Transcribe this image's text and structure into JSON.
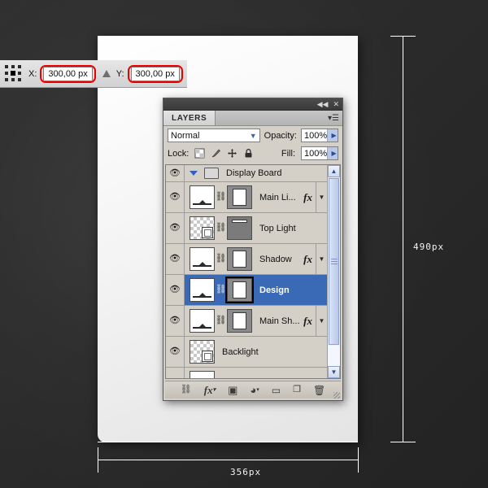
{
  "options_bar": {
    "reference_point_icon": "reference-point-grid-icon",
    "x_label": "X:",
    "x_value": "300,00 px",
    "delta_icon": "triangle-delta-icon",
    "y_label": "Y:",
    "y_value": "300,00 px",
    "highlight_color": "#ee0000"
  },
  "guides": {
    "height_label": "490px",
    "width_label": "356px",
    "line_color": "#ffffff"
  },
  "panel": {
    "titlebar": {
      "collapse_icon": "collapse-double-arrow-icon",
      "close_icon": "close-x-icon"
    },
    "tab_label": "LAYERS",
    "menu_icon": "panel-menu-icon",
    "blend_mode": "Normal",
    "blend_dropdown_icon": "chevron-down-icon",
    "opacity_label": "Opacity:",
    "opacity_value": "100%",
    "lock_label": "Lock:",
    "lock_icons": [
      "lock-transparent-pixels-icon",
      "lock-image-pixels-icon",
      "lock-position-icon",
      "lock-all-icon"
    ],
    "fill_label": "Fill:",
    "fill_value": "100%",
    "scrollbar": {
      "up_icon": "scroll-up-arrow-icon",
      "down_icon": "scroll-down-arrow-icon"
    },
    "bottom_toolbar": [
      {
        "name": "link-layers-icon",
        "glyph": "⚭"
      },
      {
        "name": "layer-style-fx-icon",
        "glyph": "fx"
      },
      {
        "name": "add-layer-mask-icon",
        "glyph": "▣"
      },
      {
        "name": "new-adjustment-layer-icon",
        "glyph": "◐"
      },
      {
        "name": "new-group-icon",
        "glyph": "▭"
      },
      {
        "name": "new-layer-icon",
        "glyph": "❐"
      },
      {
        "name": "delete-layer-icon",
        "glyph": "Ὕ1"
      }
    ],
    "layers": [
      {
        "name": "Display Board",
        "type": "group",
        "visible": true,
        "selected": false,
        "expanded": true,
        "has_fx": false,
        "has_mask": false,
        "has_thumb": false
      },
      {
        "name": "Main Li...",
        "type": "layer",
        "visible": true,
        "selected": false,
        "has_fx": true,
        "has_mask": true,
        "thumb_style": "board",
        "mask_style": "portrait"
      },
      {
        "name": "Top Light",
        "type": "layer",
        "visible": true,
        "selected": false,
        "has_fx": false,
        "has_mask": true,
        "thumb_style": "transparent",
        "mask_style": "topbar"
      },
      {
        "name": "Shadow",
        "type": "layer",
        "visible": true,
        "selected": false,
        "has_fx": true,
        "has_mask": true,
        "thumb_style": "board",
        "mask_style": "portrait"
      },
      {
        "name": "Design",
        "type": "layer",
        "visible": true,
        "selected": true,
        "has_fx": false,
        "has_mask": true,
        "thumb_style": "board",
        "mask_style": "portrait-selected"
      },
      {
        "name": "Main Sh...",
        "type": "layer",
        "visible": true,
        "selected": false,
        "has_fx": true,
        "has_mask": true,
        "thumb_style": "board",
        "mask_style": "portrait"
      },
      {
        "name": "Backlight",
        "type": "layer",
        "visible": true,
        "selected": false,
        "has_fx": false,
        "has_mask": false,
        "thumb_style": "transparent"
      }
    ]
  }
}
